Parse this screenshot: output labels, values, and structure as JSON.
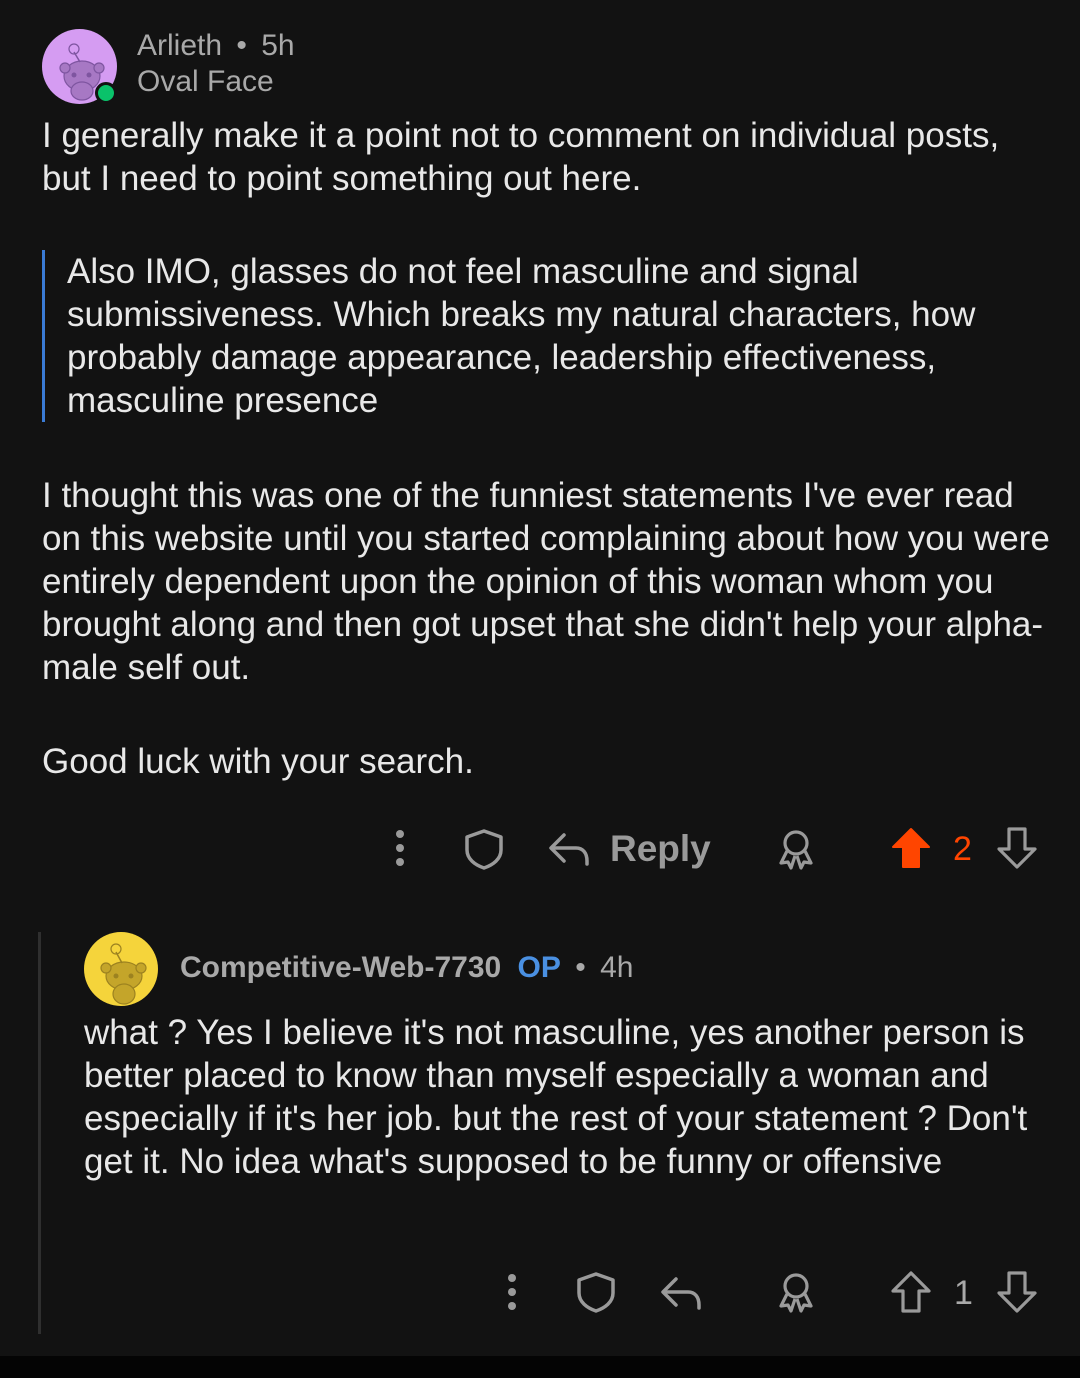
{
  "comments": [
    {
      "author": "Arlieth",
      "separator": "•",
      "age": "5h",
      "flair": "Oval Face",
      "avatar_color": "#d59cf2",
      "paragraphs": [
        "I generally make it a point not to comment on individual posts, but I need to point something out here.",
        "I thought this was one of the funniest statements I've ever read on this website until you started complaining about how you were entirely dependent upon the opinion of this woman whom you brought along and then got upset that she didn't help your alpha-male self out.",
        "Good luck with your search."
      ],
      "quote": "Also IMO, glasses do not feel masculine and signal submissiveness. Which breaks my natural characters, how probably damage appearance, leadership effectiveness, masculine presence",
      "actions": {
        "reply_label": "Reply",
        "vote_count": "2",
        "upvoted": true,
        "upvote_color": "#ff4500"
      }
    },
    {
      "author": "Competitive-Web-7730",
      "op_badge": "OP",
      "separator": "•",
      "age": "4h",
      "avatar_color": "#f5d43b",
      "paragraphs": [
        "what ? Yes I believe it's not masculine, yes another person is better placed to know than myself especially a woman and especially if it's her job. but the rest of your statement ? Don't get it. No idea what's supposed to be funny or offensive"
      ],
      "actions": {
        "vote_count": "1",
        "upvoted": false
      }
    }
  ],
  "icons": [
    "more-vertical-icon",
    "shield-icon",
    "reply-arrow-icon",
    "award-icon",
    "upvote-arrow-icon",
    "downvote-arrow-icon",
    "snoo-avatar-icon",
    "online-status-icon"
  ]
}
